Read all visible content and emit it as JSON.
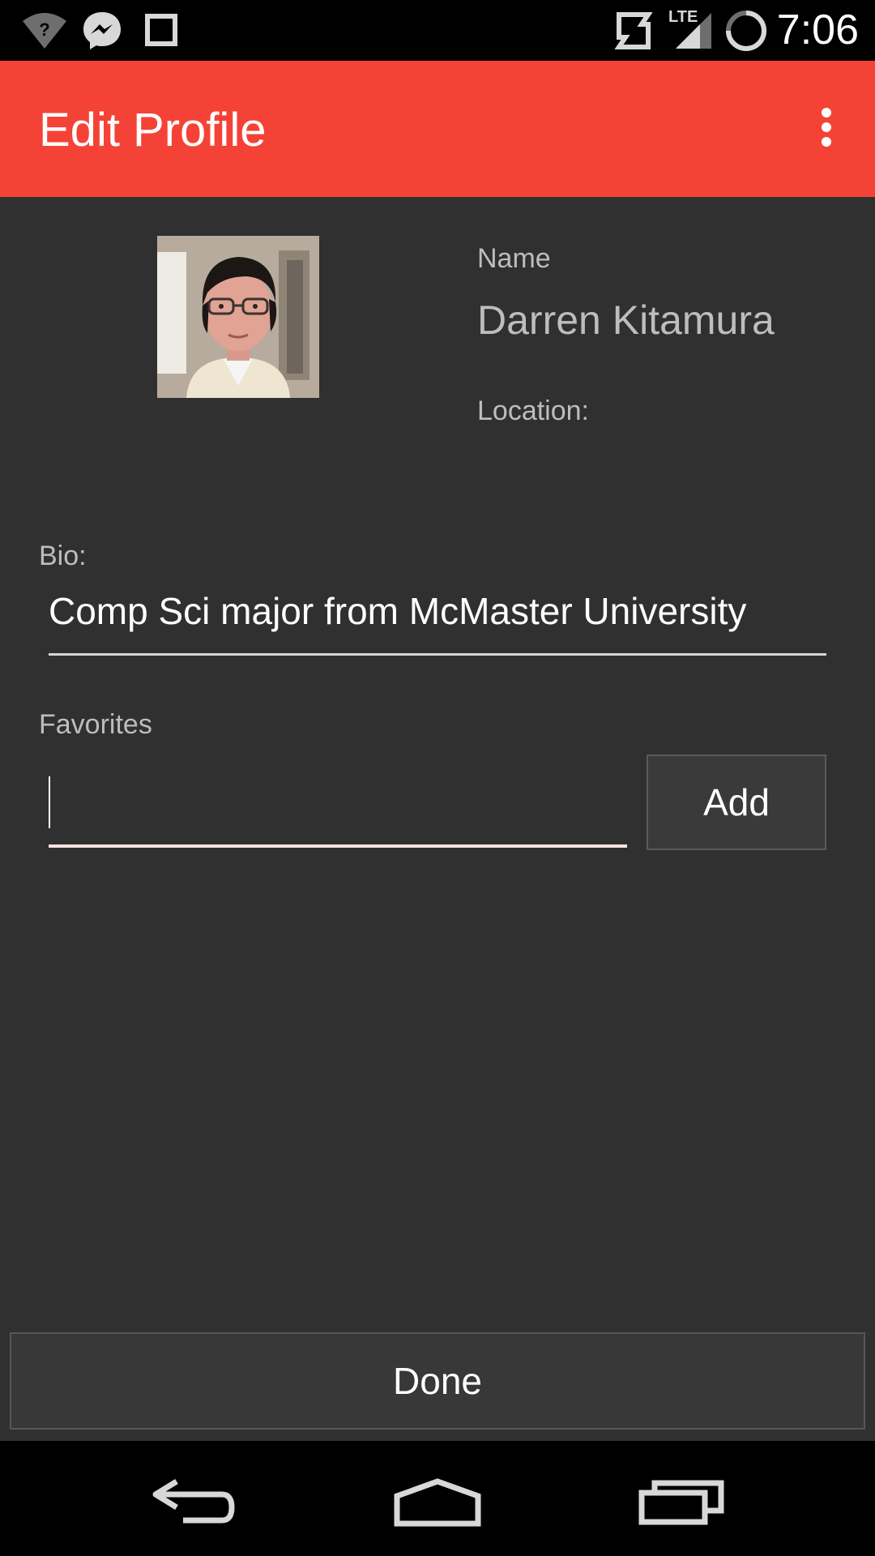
{
  "status_bar": {
    "time": "7:06",
    "network_label": "LTE",
    "icons": [
      "wifi-unknown-icon",
      "messenger-icon",
      "square-notification-icon",
      "sync-icon",
      "cell-signal-icon",
      "loading-ring-icon"
    ]
  },
  "app_bar": {
    "title": "Edit Profile",
    "overflow_icon": "more-vert-icon",
    "color": "#f44336"
  },
  "profile": {
    "name_label": "Name",
    "name_value": "Darren Kitamura",
    "location_label": "Location:",
    "location_value": ""
  },
  "bio": {
    "label": "Bio:",
    "value": "Comp Sci major from McMaster University"
  },
  "favorites": {
    "label": "Favorites",
    "input_value": "",
    "add_label": "Add"
  },
  "done_label": "Done",
  "nav_bar": {
    "icons": [
      "back-icon",
      "home-icon",
      "recent-apps-icon"
    ]
  }
}
